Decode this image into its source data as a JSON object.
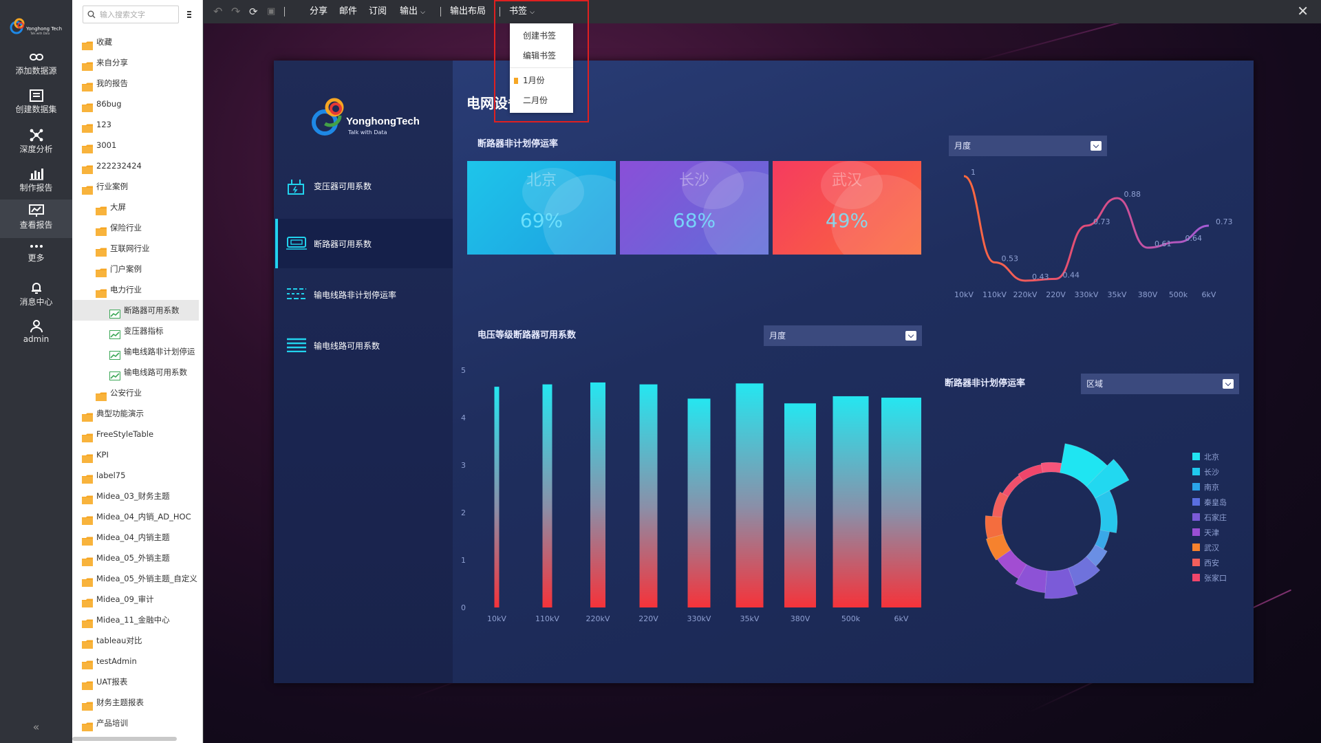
{
  "rail": {
    "logo_text": "Yonghong Tech",
    "logo_sub": "Talk with Data",
    "items": [
      {
        "label": "添加数据源",
        "icon": "link-icon"
      },
      {
        "label": "创建数据集",
        "icon": "dataset-icon"
      },
      {
        "label": "深度分析",
        "icon": "analysis-icon"
      },
      {
        "label": "制作报告",
        "icon": "chart-report-icon"
      },
      {
        "label": "查看报告",
        "icon": "view-report-icon"
      },
      {
        "label": "更多",
        "icon": "more-icon"
      },
      {
        "label": "消息中心",
        "icon": "bell-icon"
      },
      {
        "label": "admin",
        "icon": "user-icon"
      }
    ],
    "active_index": 4,
    "collapse": "«"
  },
  "tree": {
    "search_placeholder": "输入搜索文字",
    "items": [
      {
        "label": "收藏",
        "type": "folder",
        "level": 0
      },
      {
        "label": "来自分享",
        "type": "folder",
        "level": 0
      },
      {
        "label": "我的报告",
        "type": "folder",
        "level": 0
      },
      {
        "label": "86bug",
        "type": "folder",
        "level": 0
      },
      {
        "label": "123",
        "type": "folder",
        "level": 0
      },
      {
        "label": "3001",
        "type": "folder",
        "level": 0
      },
      {
        "label": "222232424",
        "type": "folder",
        "level": 0
      },
      {
        "label": "行业案例",
        "type": "folder-open",
        "level": 0
      },
      {
        "label": "大屏",
        "type": "folder",
        "level": 1
      },
      {
        "label": "保险行业",
        "type": "folder",
        "level": 1
      },
      {
        "label": "互联网行业",
        "type": "folder",
        "level": 1
      },
      {
        "label": "门户案例",
        "type": "folder",
        "level": 1
      },
      {
        "label": "电力行业",
        "type": "folder-open",
        "level": 1
      },
      {
        "label": "断路器可用系数",
        "type": "report",
        "level": 2,
        "selected": true
      },
      {
        "label": "变压器指标",
        "type": "report",
        "level": 2
      },
      {
        "label": "输电线路非计划停运",
        "type": "report",
        "level": 2
      },
      {
        "label": "输电线路可用系数",
        "type": "report",
        "level": 2
      },
      {
        "label": "公安行业",
        "type": "folder",
        "level": 1
      },
      {
        "label": "典型功能演示",
        "type": "folder",
        "level": 0
      },
      {
        "label": "FreeStyleTable",
        "type": "folder",
        "level": 0
      },
      {
        "label": "KPI",
        "type": "folder",
        "level": 0
      },
      {
        "label": "label75",
        "type": "folder",
        "level": 0
      },
      {
        "label": "Midea_03_财务主题",
        "type": "folder",
        "level": 0
      },
      {
        "label": "Midea_04_内销_AD_HOC",
        "type": "folder",
        "level": 0
      },
      {
        "label": "Midea_04_内销主题",
        "type": "folder",
        "level": 0
      },
      {
        "label": "Midea_05_外销主题",
        "type": "folder",
        "level": 0
      },
      {
        "label": "Midea_05_外销主题_自定义",
        "type": "folder",
        "level": 0
      },
      {
        "label": "Midea_09_审计",
        "type": "folder",
        "level": 0
      },
      {
        "label": "Midea_11_金融中心",
        "type": "folder",
        "level": 0
      },
      {
        "label": "tableau对比",
        "type": "folder",
        "level": 0
      },
      {
        "label": "testAdmin",
        "type": "folder",
        "level": 0
      },
      {
        "label": "UAT报表",
        "type": "folder",
        "level": 0
      },
      {
        "label": "财务主题报表",
        "type": "folder",
        "level": 0
      },
      {
        "label": "产品培训",
        "type": "folder",
        "level": 0
      }
    ]
  },
  "toolbar": {
    "share": "分享",
    "mail": "邮件",
    "subscribe": "订阅",
    "export": "输出",
    "export_layout": "输出布局",
    "bookmark": "书签"
  },
  "bookmark_menu": {
    "create": "创建书签",
    "edit": "编辑书签",
    "items": [
      "1月份",
      "二月份"
    ]
  },
  "dashboard": {
    "title": "电网设备分析",
    "brand_name": "YonghongTech",
    "brand_sub": "Talk with Data",
    "nav": [
      "变压器可用系数",
      "断路器可用系数",
      "输电线路非计划停运率",
      "输电线路可用系数"
    ],
    "nav_active": 1,
    "section_rate": "断路器非计划停运率",
    "cards": [
      {
        "city": "北京",
        "pct": "69%"
      },
      {
        "city": "长沙",
        "pct": "68%"
      },
      {
        "city": "武汉",
        "pct": "49%"
      }
    ],
    "select_month_1": "月度",
    "section_voltage": "电压等级断路器可用系数",
    "select_month_2": "月度",
    "section_donut": "断路器非计划停运率",
    "select_region": "区域"
  },
  "colors": {
    "accent_cyan": "#22d3ee",
    "card1": "#1fb4e6",
    "card2": "#7a5ad6",
    "card3": "#f24a56",
    "highlight_red": "#e02020"
  },
  "chart_data": [
    {
      "type": "line",
      "x": [
        "10kV",
        "110kV",
        "220kV",
        "220V",
        "330kV",
        "35kV",
        "380V",
        "500k",
        "6kV"
      ],
      "values": [
        1,
        0.53,
        0.43,
        0.44,
        0.73,
        0.88,
        0.61,
        0.64,
        0.73
      ],
      "labels": [
        "1",
        "0.53",
        "0.43",
        "0.44",
        "0.73",
        "0.88",
        "0.61",
        "0.64",
        "0.73"
      ],
      "ylim": [
        0.4,
        1.0
      ]
    },
    {
      "type": "bar",
      "categories": [
        "10kV",
        "110kV",
        "220kV",
        "220V",
        "330kV",
        "35kV",
        "380V",
        "500k",
        "6kV"
      ],
      "values": [
        4.65,
        4.7,
        4.74,
        4.7,
        4.4,
        4.72,
        4.3,
        4.45,
        4.42
      ],
      "yticks": [
        "0",
        "1",
        "2",
        "3",
        "4",
        "5"
      ],
      "ylim": [
        0,
        5
      ]
    },
    {
      "type": "pie",
      "variant": "nightingale-donut",
      "legend": [
        "北京",
        "长沙",
        "南京",
        "秦皇岛",
        "石家庄",
        "天津",
        "武汉",
        "西安",
        "张家口"
      ],
      "legend_colors": [
        "#22e3f2",
        "#20c8ee",
        "#2aa4ea",
        "#5a6fe0",
        "#7b5bd8",
        "#9a4fd4",
        "#f6822e",
        "#f25f5c",
        "#f0466b"
      ]
    }
  ]
}
